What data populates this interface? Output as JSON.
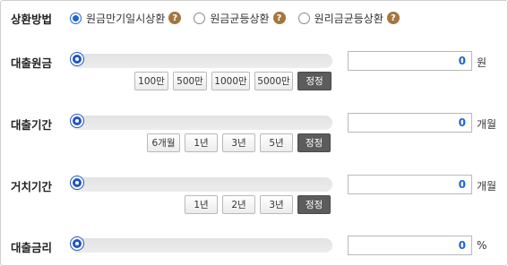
{
  "repayment": {
    "title": "상환방법",
    "options": [
      {
        "label": "원금만기일시상환",
        "selected": true
      },
      {
        "label": "원금균등상환",
        "selected": false
      },
      {
        "label": "원리금균등상환",
        "selected": false
      }
    ],
    "help_glyph": "?"
  },
  "rows": {
    "principal": {
      "label": "대출원금",
      "value": "0",
      "unit": "원",
      "slider_fraction": 0,
      "buttons": [
        "100만",
        "500만",
        "1000만",
        "5000만"
      ],
      "reset": "정정"
    },
    "period": {
      "label": "대출기간",
      "value": "0",
      "unit": "개월",
      "slider_fraction": 0,
      "buttons": [
        "6개월",
        "1년",
        "3년",
        "5년"
      ],
      "reset": "정정"
    },
    "grace": {
      "label": "거치기간",
      "value": "0",
      "unit": "개월",
      "slider_fraction": 0,
      "buttons": [
        "1년",
        "2년",
        "3년"
      ],
      "reset": "정정"
    },
    "rate": {
      "label": "대출금리",
      "value": "0",
      "unit": "%",
      "slider_fraction": 0
    }
  },
  "colors": {
    "accent": "#1e66d0",
    "slider_thumb": "#2056c4",
    "help_icon": "#a5763e",
    "reset_button": "#5c5c5c"
  }
}
